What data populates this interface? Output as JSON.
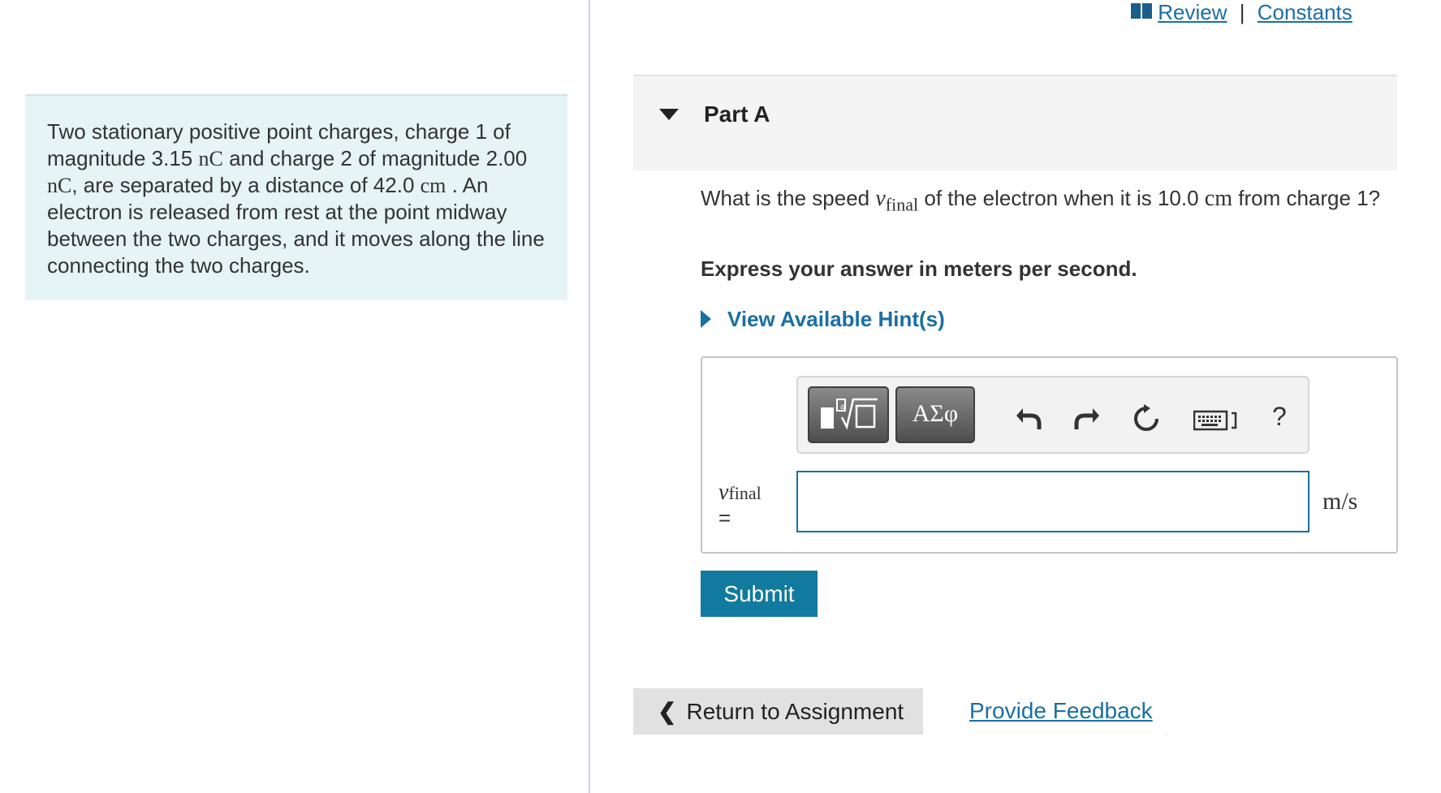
{
  "header": {
    "review_label": "Review",
    "separator": "|",
    "constants_label": "Constants"
  },
  "problem": {
    "p1": "Two stationary positive point charges, charge 1 of magnitude 3.15",
    "u1": "nC",
    "p2": "and charge 2 of magnitude 2.00",
    "u2": "nC",
    "p3": ", are separated by a distance of 42.0",
    "u3": "cm",
    "p4": ". An electron is released from rest at the point midway between the two charges, and it moves along the line connecting the two charges."
  },
  "part": {
    "title": "Part A",
    "question_pre": "What is the speed",
    "var": "v",
    "var_sub": "final",
    "question_mid": "of the electron when it is 10.0",
    "question_unit": "cm",
    "question_post": "from charge 1?",
    "instruction": "Express your answer in meters per second.",
    "hints_label": "View Available Hint(s)"
  },
  "toolbar": {
    "greek_label": "ΑΣφ",
    "help_label": "?"
  },
  "answer": {
    "var": "v",
    "var_sub": "final",
    "equals": "=",
    "value": "",
    "unit": "m/s"
  },
  "actions": {
    "submit_label": "Submit",
    "return_label": "Return to Assignment",
    "feedback_label": "Provide Feedback"
  },
  "colors": {
    "link": "#1a6fa3",
    "submit_bg": "#117a9e",
    "problem_bg": "#e6f4f5"
  },
  "icons": [
    "book-icon",
    "caret-down-icon",
    "triangle-right-icon",
    "templates-icon",
    "undo-icon",
    "redo-icon",
    "reset-icon",
    "keyboard-icon",
    "chevron-left-icon"
  ]
}
